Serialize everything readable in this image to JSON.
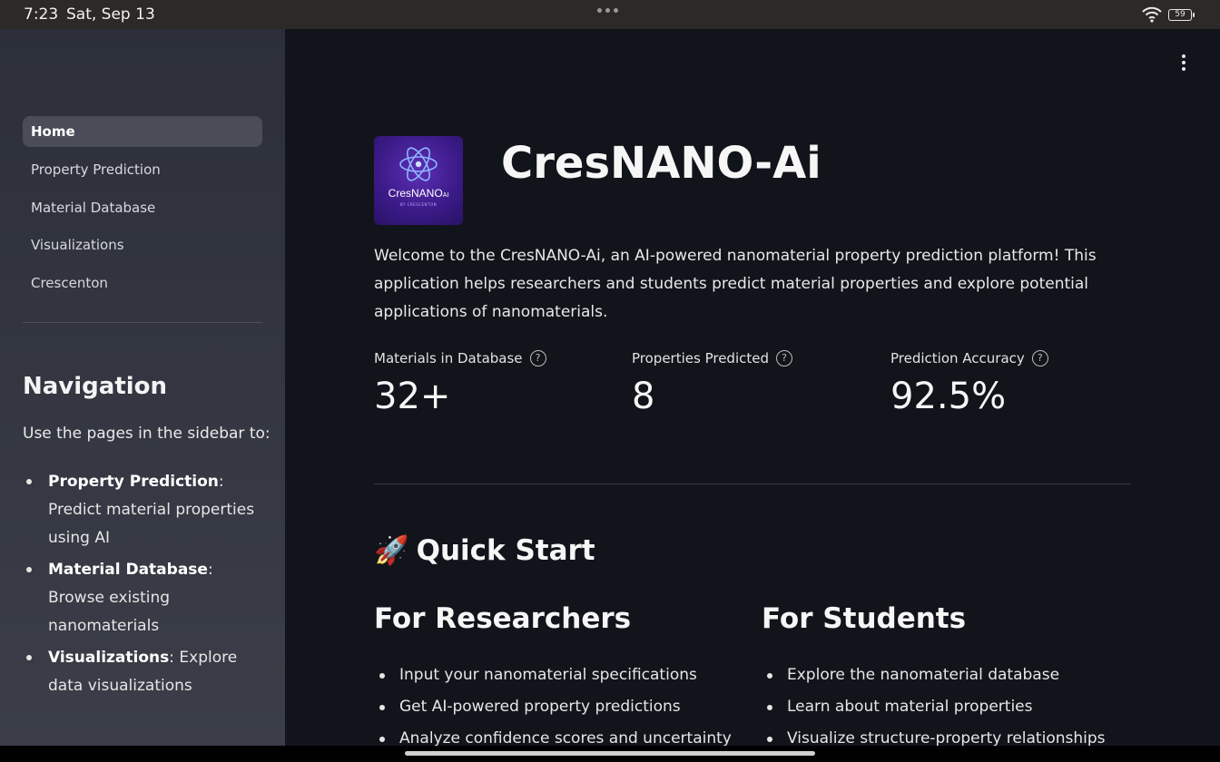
{
  "status_bar": {
    "time": "7:23",
    "date": "Sat, Sep 13",
    "battery": "59",
    "icons": [
      "wifi-icon",
      "battery-icon"
    ]
  },
  "sidebar": {
    "items": [
      {
        "label": "Home",
        "active": true
      },
      {
        "label": "Property Prediction",
        "active": false
      },
      {
        "label": "Material Database",
        "active": false
      },
      {
        "label": "Visualizations",
        "active": false
      },
      {
        "label": "Crescenton",
        "active": false
      }
    ],
    "heading": "Navigation",
    "intro": "Use the pages in the sidebar to:",
    "bullets": [
      {
        "title": "Property Prediction",
        "desc": ": Predict material properties using AI"
      },
      {
        "title": "Material Database",
        "desc": ": Browse existing nanomaterials"
      },
      {
        "title": "Visualizations",
        "desc": ": Explore data visualizations"
      }
    ]
  },
  "main": {
    "logo": {
      "text": "CresNANO",
      "suffix": "AI",
      "sub": "BY CRESCENTON"
    },
    "title": "CresNANO-Ai",
    "welcome": "Welcome to the CresNANO-Ai, an AI-powered nanomaterial property prediction platform! This application helps researchers and students predict material properties and explore potential applications of nanomaterials.",
    "metrics": [
      {
        "label": "Materials in Database",
        "value": "32+"
      },
      {
        "label": "Properties Predicted",
        "value": "8"
      },
      {
        "label": "Prediction Accuracy",
        "value": "92.5%"
      }
    ],
    "help_symbol": "?",
    "quick_start": {
      "emoji": "🚀",
      "label": "Quick Start"
    },
    "researchers": {
      "heading": "For Researchers",
      "items": [
        "Input your nanomaterial specifications",
        "Get AI-powered property predictions",
        "Analyze confidence scores and uncertainty"
      ]
    },
    "students": {
      "heading": "For Students",
      "items": [
        "Explore the nanomaterial database",
        "Learn about material properties",
        "Visualize structure-property relationships"
      ]
    }
  },
  "colors": {
    "sidebar_bg": "#2c2f3a",
    "main_bg": "#12141b",
    "active_item_bg": "#4a4d58",
    "logo_bg": "#3a1a86"
  }
}
